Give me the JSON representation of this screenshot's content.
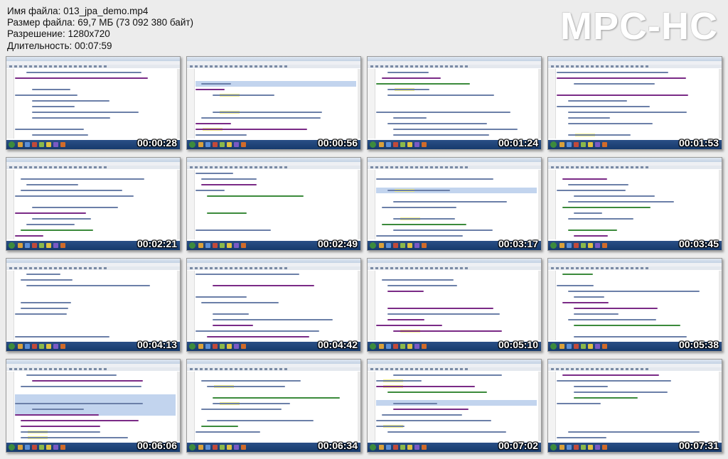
{
  "info": {
    "filename": "Имя файла: 013_jpa_demo.mp4",
    "filesize": "Размер файла: 69,7 МБ (73 092 380 байт)",
    "resolution": "Разрешение: 1280x720",
    "duration": "Длительность: 00:07:59"
  },
  "logo": "MPC-HC",
  "thumbnails": [
    {
      "timestamp": "00:00:28"
    },
    {
      "timestamp": "00:00:56"
    },
    {
      "timestamp": "00:01:24"
    },
    {
      "timestamp": "00:01:53"
    },
    {
      "timestamp": "00:02:21"
    },
    {
      "timestamp": "00:02:49"
    },
    {
      "timestamp": "00:03:17"
    },
    {
      "timestamp": "00:03:45"
    },
    {
      "timestamp": "00:04:13"
    },
    {
      "timestamp": "00:04:42"
    },
    {
      "timestamp": "00:05:10"
    },
    {
      "timestamp": "00:05:38"
    },
    {
      "timestamp": "00:06:06"
    },
    {
      "timestamp": "00:06:34"
    },
    {
      "timestamp": "00:07:02"
    },
    {
      "timestamp": "00:07:31"
    }
  ]
}
